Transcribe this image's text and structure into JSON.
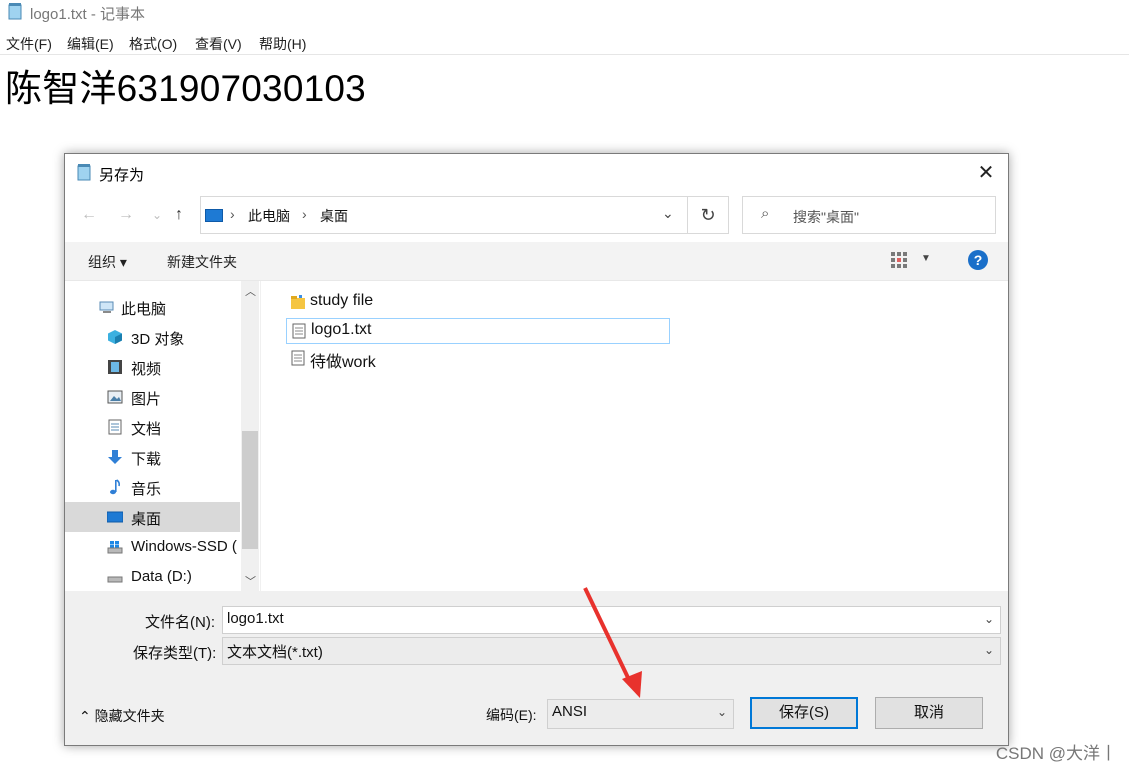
{
  "notepad": {
    "window_title": "logo1.txt - 记事本",
    "menu": [
      "文件(F)",
      "编辑(E)",
      "格式(O)",
      "查看(V)",
      "帮助(H)"
    ],
    "content": "陈智洋631907030103"
  },
  "dialog": {
    "title": "另存为",
    "close": "✕",
    "nav": {
      "back": "←",
      "forward": "→",
      "recent": "⌄",
      "up": "↑"
    },
    "address": {
      "crumbs": [
        "此电脑",
        "桌面"
      ],
      "separator": "›",
      "dropdown": "⌄",
      "refresh": "↻"
    },
    "search": {
      "icon": "⌕",
      "placeholder": "搜索\"桌面\""
    },
    "toolbar": {
      "organize": "组织 ▾",
      "new_folder": "新建文件夹",
      "view_dropdown": "▼",
      "help": "?"
    },
    "nav_pane": {
      "items": [
        {
          "label": "此电脑",
          "icon": "pc-icon"
        },
        {
          "label": "3D 对象",
          "icon": "cube-icon"
        },
        {
          "label": "视频",
          "icon": "video-icon"
        },
        {
          "label": "图片",
          "icon": "picture-icon"
        },
        {
          "label": "文档",
          "icon": "document-icon"
        },
        {
          "label": "下载",
          "icon": "download-icon"
        },
        {
          "label": "音乐",
          "icon": "music-icon"
        },
        {
          "label": "桌面",
          "icon": "desktop-icon",
          "selected": true
        },
        {
          "label": "Windows-SSD (",
          "icon": "drive-icon"
        },
        {
          "label": "Data (D:)",
          "icon": "drive-icon"
        }
      ],
      "scroll_up": "︿",
      "scroll_down": "﹀"
    },
    "files": [
      {
        "name": "study file",
        "icon": "folder-icon"
      },
      {
        "name": "logo1.txt",
        "icon": "text-file-icon",
        "selected": true
      },
      {
        "name": "待做work",
        "icon": "text-file-icon"
      }
    ],
    "filename": {
      "label": "文件名(N):",
      "value": "logo1.txt",
      "dropdown": "⌄"
    },
    "filetype": {
      "label": "保存类型(T):",
      "value": "文本文档(*.txt)",
      "dropdown": "⌄"
    },
    "hide_folders": "⌃ 隐藏文件夹",
    "encoding": {
      "label": "编码(E):",
      "value": "ANSI",
      "dropdown": "⌄"
    },
    "save_button": "保存(S)",
    "cancel_button": "取消"
  },
  "watermark": "CSDN @大洋丨",
  "colors": {
    "accent": "#0078d7",
    "annotation_arrow": "#e8322d",
    "help_blue": "#1a6fc9"
  }
}
